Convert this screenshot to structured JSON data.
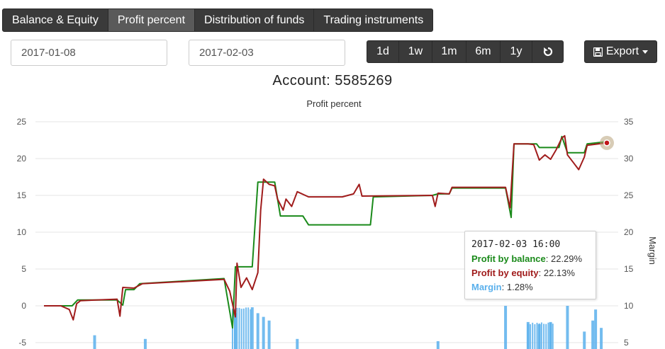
{
  "tabs": [
    {
      "label": "Balance & Equity",
      "active": false
    },
    {
      "label": "Profit percent",
      "active": true
    },
    {
      "label": "Distribution of funds",
      "active": false
    },
    {
      "label": "Trading instruments",
      "active": false
    }
  ],
  "filters": {
    "date_from": "2017-01-08",
    "date_to": "2017-02-03"
  },
  "range_buttons": [
    "1d",
    "1w",
    "1m",
    "6m",
    "1y"
  ],
  "reset_icon": "refresh-icon",
  "export": {
    "label": "Export",
    "icon": "floppy-disk-icon"
  },
  "account": {
    "label": "Account:",
    "number": "5585269"
  },
  "colors": {
    "balance": "#1a8a1a",
    "equity": "#a01c1c",
    "margin": "#5ab0ec",
    "toolbar": "#3a3a3a"
  },
  "chart_data": {
    "type": "line",
    "title": "Profit percent",
    "y_left": {
      "ticks": [
        "25",
        "20",
        "15",
        "10",
        "5",
        "0",
        "-5"
      ],
      "range": [
        -5,
        25
      ]
    },
    "y_right": {
      "label": "Margin",
      "ticks": [
        "35",
        "30",
        "25",
        "20",
        "15",
        "10",
        "5"
      ],
      "range": [
        5,
        35
      ]
    },
    "x": {
      "range": [
        "2017-01-08",
        "2017-02-03 16:00"
      ]
    },
    "grid": true,
    "series": [
      {
        "name": "Profit by balance",
        "axis": "left",
        "style": "line",
        "points": [
          [
            0,
            0
          ],
          [
            0.05,
            0
          ],
          [
            0.06,
            0.8
          ],
          [
            0.13,
            0.8
          ],
          [
            0.14,
            0.1
          ],
          [
            0.145,
            2.2
          ],
          [
            0.16,
            2.2
          ],
          [
            0.17,
            3
          ],
          [
            0.32,
            3.7
          ],
          [
            0.335,
            -3
          ],
          [
            0.34,
            5.3
          ],
          [
            0.37,
            5.3
          ],
          [
            0.38,
            16.8
          ],
          [
            0.41,
            16.8
          ],
          [
            0.42,
            12.2
          ],
          [
            0.46,
            12.2
          ],
          [
            0.47,
            11
          ],
          [
            0.58,
            11
          ],
          [
            0.585,
            14.8
          ],
          [
            0.69,
            15
          ],
          [
            0.7,
            15.2
          ],
          [
            0.72,
            15.2
          ],
          [
            0.725,
            16
          ],
          [
            0.82,
            16
          ],
          [
            0.83,
            12
          ],
          [
            0.835,
            22
          ],
          [
            0.87,
            22
          ],
          [
            0.875,
            22
          ],
          [
            0.88,
            21.5
          ],
          [
            0.915,
            21.5
          ],
          [
            0.92,
            23
          ],
          [
            0.93,
            20.8
          ],
          [
            0.96,
            20.8
          ],
          [
            0.965,
            22
          ],
          [
            1,
            22.3
          ]
        ]
      },
      {
        "name": "Profit by equity",
        "axis": "left",
        "style": "line",
        "points": [
          [
            0,
            0
          ],
          [
            0.03,
            0
          ],
          [
            0.045,
            -0.5
          ],
          [
            0.052,
            -1.9
          ],
          [
            0.058,
            0.3
          ],
          [
            0.065,
            0.7
          ],
          [
            0.13,
            0.9
          ],
          [
            0.135,
            -1.4
          ],
          [
            0.14,
            2.5
          ],
          [
            0.16,
            2.4
          ],
          [
            0.175,
            3
          ],
          [
            0.32,
            3.6
          ],
          [
            0.33,
            2
          ],
          [
            0.34,
            -1.5
          ],
          [
            0.343,
            5.8
          ],
          [
            0.35,
            2.5
          ],
          [
            0.36,
            3.8
          ],
          [
            0.37,
            2.2
          ],
          [
            0.38,
            4.5
          ],
          [
            0.385,
            13
          ],
          [
            0.39,
            17.2
          ],
          [
            0.4,
            16.5
          ],
          [
            0.41,
            16.3
          ],
          [
            0.415,
            14.5
          ],
          [
            0.425,
            13
          ],
          [
            0.43,
            14.5
          ],
          [
            0.44,
            13.5
          ],
          [
            0.45,
            15.5
          ],
          [
            0.47,
            14.8
          ],
          [
            0.53,
            14.8
          ],
          [
            0.55,
            15.2
          ],
          [
            0.56,
            16.5
          ],
          [
            0.565,
            14.9
          ],
          [
            0.69,
            15
          ],
          [
            0.695,
            13.5
          ],
          [
            0.7,
            15.3
          ],
          [
            0.72,
            15.2
          ],
          [
            0.725,
            16.1
          ],
          [
            0.82,
            16.1
          ],
          [
            0.828,
            13.3
          ],
          [
            0.835,
            22
          ],
          [
            0.86,
            22
          ],
          [
            0.87,
            21.9
          ],
          [
            0.88,
            19.8
          ],
          [
            0.89,
            20.5
          ],
          [
            0.9,
            19.9
          ],
          [
            0.91,
            21.2
          ],
          [
            0.92,
            22.8
          ],
          [
            0.925,
            23.1
          ],
          [
            0.93,
            20.5
          ],
          [
            0.94,
            19.5
          ],
          [
            0.95,
            18.5
          ],
          [
            0.96,
            20.2
          ],
          [
            0.965,
            21.8
          ],
          [
            1,
            22.13
          ]
        ]
      },
      {
        "name": "Margin",
        "axis": "right",
        "style": "bars",
        "points": [
          [
            0.09,
            6
          ],
          [
            0.18,
            5.5
          ],
          [
            0.34,
            9
          ],
          [
            0.37,
            9.8
          ],
          [
            0.38,
            9
          ],
          [
            0.39,
            8.5
          ],
          [
            0.4,
            8
          ],
          [
            0.45,
            5.5
          ],
          [
            0.7,
            5.2
          ],
          [
            0.82,
            10
          ],
          [
            0.86,
            7.8
          ],
          [
            0.88,
            7.5
          ],
          [
            0.9,
            7.8
          ],
          [
            0.93,
            10
          ],
          [
            0.96,
            6.5
          ],
          [
            0.975,
            8
          ],
          [
            0.98,
            9.5
          ],
          [
            0.99,
            7
          ]
        ]
      }
    ],
    "tooltip": {
      "title": "2017-02-03 16:00",
      "rows": [
        {
          "name": "Profit by balance",
          "value": "22.29%"
        },
        {
          "name": "Profit by equity",
          "value": "22.13%"
        },
        {
          "name": "Margin",
          "value": "1.28%"
        }
      ]
    }
  }
}
